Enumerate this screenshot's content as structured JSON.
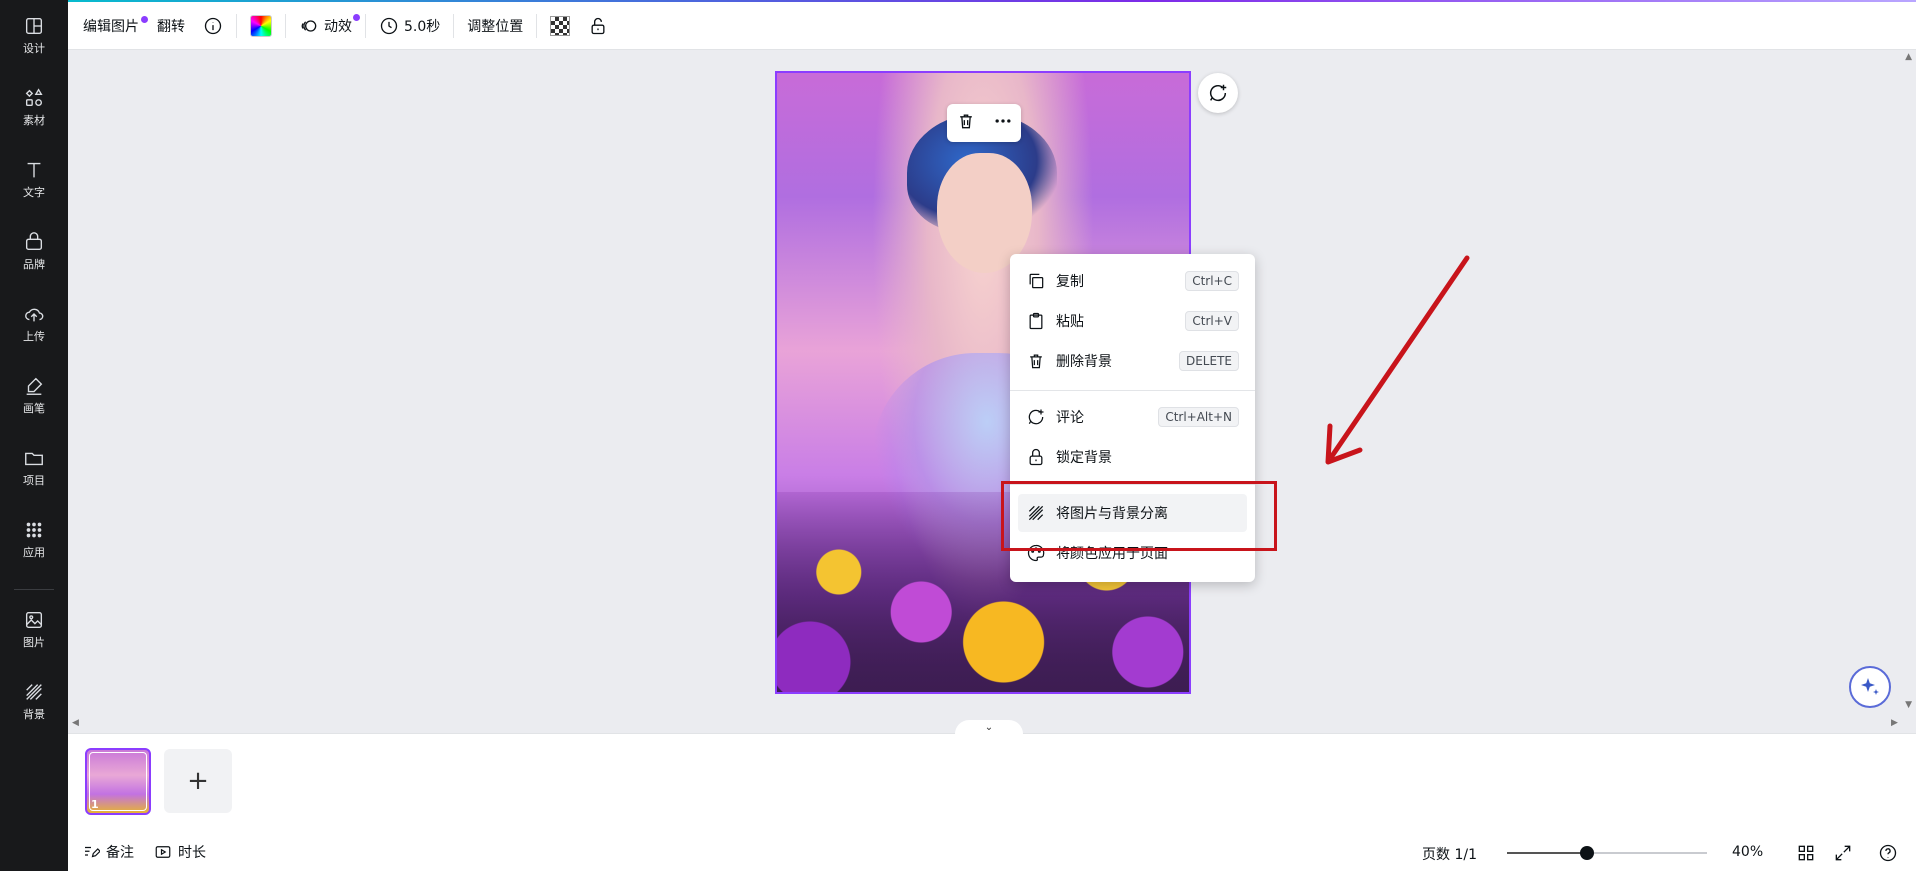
{
  "sidebar": {
    "items": [
      {
        "label": "设计",
        "icon": "layout-icon"
      },
      {
        "label": "素材",
        "icon": "shapes-icon"
      },
      {
        "label": "文字",
        "icon": "text-icon"
      },
      {
        "label": "品牌",
        "icon": "brand-icon"
      },
      {
        "label": "上传",
        "icon": "cloud-upload-icon"
      },
      {
        "label": "画笔",
        "icon": "pen-icon"
      },
      {
        "label": "项目",
        "icon": "folder-icon"
      },
      {
        "label": "应用",
        "icon": "apps-grid-icon"
      },
      {
        "label": "图片",
        "icon": "image-icon"
      },
      {
        "label": "背景",
        "icon": "background-stripes-icon"
      }
    ]
  },
  "toolbar": {
    "edit_image": "编辑图片",
    "flip": "翻转",
    "animate": "动效",
    "duration": "5.0秒",
    "position": "调整位置",
    "badge_color": "#8b3dff"
  },
  "context_menu": {
    "items": [
      {
        "label": "复制",
        "shortcut": "Ctrl+C",
        "icon": "copy-icon"
      },
      {
        "label": "粘贴",
        "shortcut": "Ctrl+V",
        "icon": "paste-icon"
      },
      {
        "label": "删除背景",
        "shortcut": "DELETE",
        "icon": "trash-icon"
      },
      {
        "label": "评论",
        "shortcut": "Ctrl+Alt+N",
        "icon": "comment-add-icon"
      },
      {
        "label": "锁定背景",
        "shortcut": "",
        "icon": "lock-icon"
      },
      {
        "label": "将图片与背景分离",
        "shortcut": "",
        "icon": "background-stripes-icon"
      },
      {
        "label": "将颜色应用于页面",
        "shortcut": "",
        "icon": "palette-icon"
      }
    ]
  },
  "annotation": {
    "color": "#c8141b"
  },
  "pages": {
    "thumbnail_number": "1",
    "add_page": "+"
  },
  "footer": {
    "notes": "备注",
    "duration": "时长",
    "page_count": "页数 1/1",
    "zoom_percent": "40%",
    "zoom_value": 0.4
  }
}
